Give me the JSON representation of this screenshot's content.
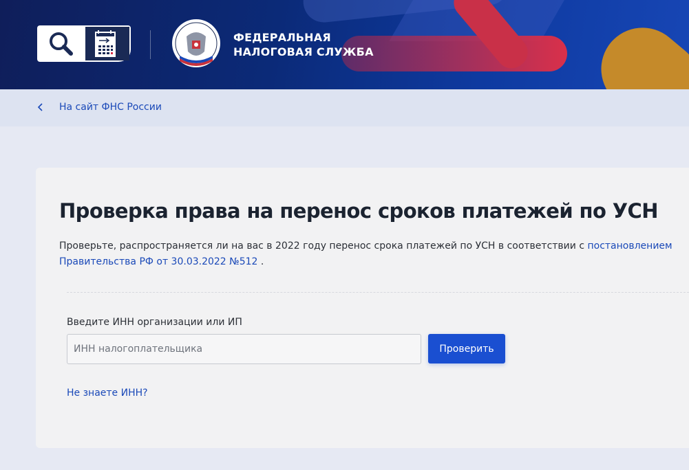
{
  "header": {
    "org_name_line1": "ФЕДЕРАЛЬНАЯ",
    "org_name_line2": "НАЛОГОВАЯ СЛУЖБА",
    "emblem_text": "ФЕДЕРАЛЬНАЯ НАЛОГОВАЯ СЛУЖБА",
    "colors": {
      "banner_dark": "#0f1e5a",
      "banner_blue": "#1746b5",
      "accent_red": "#d9304a",
      "accent_orange": "#c58a2a"
    },
    "icons": [
      "search-icon",
      "calendar-icon",
      "emblem-icon"
    ]
  },
  "breadcrumb": {
    "back_label": "На сайт ФНС России",
    "icon": "chevron-left-icon"
  },
  "card": {
    "title": "Проверка права на перенос сроков платежей по УСН",
    "description_text": "Проверьте, распространяется ли на вас в 2022 году перенос срока платежей по УСН в соответствии с ",
    "description_link": "постановлением Правительства РФ от 30.03.2022 №512",
    "description_end": " .",
    "field_label": "Введите ИНН организации или ИП",
    "input_placeholder": "ИНН налогоплательщика",
    "input_value": "",
    "submit_label": "Проверить",
    "help_link": "Не знаете ИНН?"
  },
  "theme": {
    "link_color": "#1a49b8",
    "button_color": "#1a4fd1",
    "page_bg": "#e6e9f3",
    "card_bg": "#f2f2f3"
  }
}
